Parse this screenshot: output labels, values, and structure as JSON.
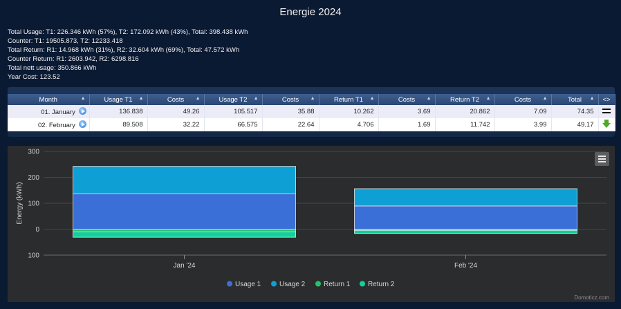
{
  "title": "Energie 2024",
  "summary": [
    "Total Usage: T1: 226.346 kWh (57%), T2: 172.092 kWh (43%), Total: 398.438 kWh",
    "Counter: T1: 19505.873, T2: 12233.418",
    "Total Return: R1: 14.968 kWh (31%), R2: 32.604 kWh (69%), Total: 47.572 kWh",
    "Counter Return: R1: 2603.942, R2: 6298.816",
    "Total nett usage: 350.866 kWh",
    "Year Cost: 123.52"
  ],
  "table": {
    "headers": [
      "Month",
      "Usage T1",
      "Costs",
      "Usage T2",
      "Costs",
      "Return T1",
      "Costs",
      "Return T2",
      "Costs",
      "Total",
      "<>"
    ],
    "rows": [
      {
        "month": "01. January",
        "cells": [
          "136.838",
          "49.26",
          "105.517",
          "35.88",
          "10.262",
          "3.69",
          "20.862",
          "7.09",
          "74.35"
        ],
        "trend": "equal-icon"
      },
      {
        "month": "02. February",
        "cells": [
          "89.508",
          "32.22",
          "66.575",
          "22.64",
          "4.706",
          "1.69",
          "11.742",
          "3.99",
          "49.17"
        ],
        "trend": "arrow-down-icon"
      }
    ]
  },
  "chart_data": {
    "type": "bar",
    "stacked": true,
    "categories": [
      "Jan '24",
      "Feb '24"
    ],
    "series": [
      {
        "name": "Usage 1",
        "values": [
          136.838,
          89.508
        ],
        "color": "#3a6fd8"
      },
      {
        "name": "Usage 2",
        "values": [
          105.517,
          66.575
        ],
        "color": "#0ea0d4"
      },
      {
        "name": "Return 1",
        "values": [
          -10.262,
          -4.706
        ],
        "color": "#27c26a"
      },
      {
        "name": "Return 2",
        "values": [
          -20.862,
          -11.742
        ],
        "color": "#14cf9b"
      }
    ],
    "ylabel": "Energy (kWh)",
    "ylim": [
      -100,
      300
    ],
    "yticks": [
      300,
      200,
      100,
      0,
      -100
    ],
    "ytick_labels": [
      "300",
      "200",
      "100",
      "0",
      "100"
    ],
    "grid": true,
    "legend": "bottom-center",
    "credit": "Domoticz.com"
  }
}
